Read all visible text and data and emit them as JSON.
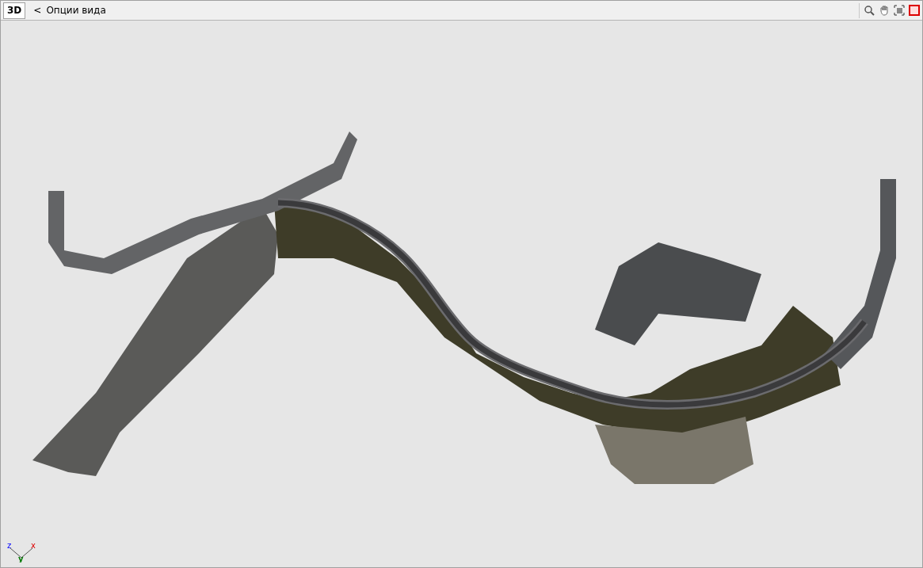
{
  "toolbar": {
    "view_mode": "3D",
    "back": "<",
    "title": "Опции вида"
  },
  "axes": {
    "z": "z",
    "y": "y",
    "x": "x"
  }
}
